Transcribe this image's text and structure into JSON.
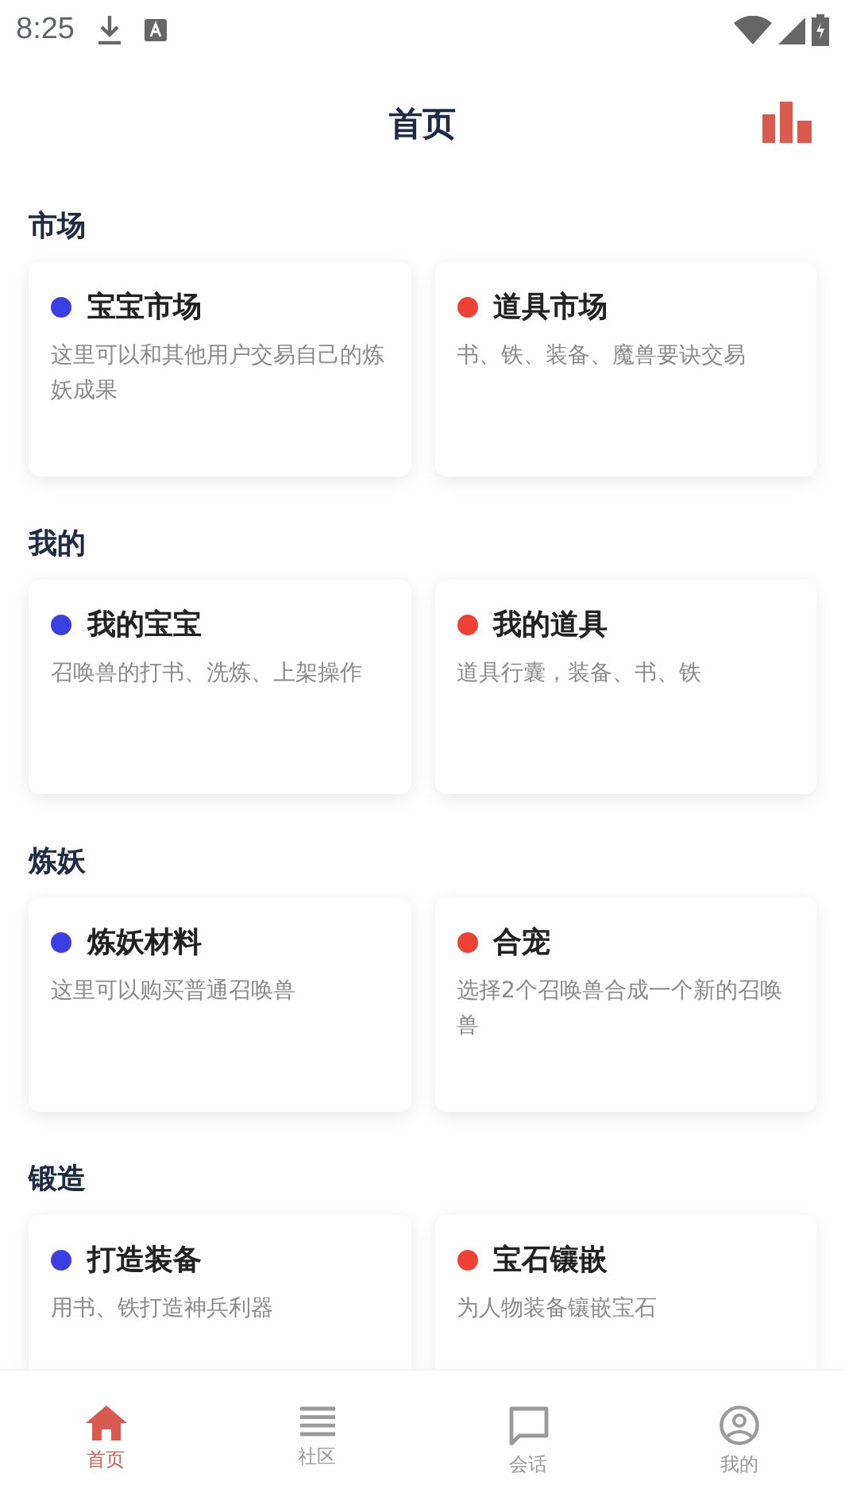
{
  "status_bar": {
    "time": "8:25"
  },
  "header": {
    "title": "首页"
  },
  "sections": [
    {
      "title": "市场",
      "cards": [
        {
          "title": "宝宝市场",
          "description": "这里可以和其他用户交易自己的炼妖成果",
          "color": "#3b3ee0"
        },
        {
          "title": "道具市场",
          "description": "书、铁、装备、魔兽要诀交易",
          "color": "#ef4136"
        }
      ]
    },
    {
      "title": "我的",
      "cards": [
        {
          "title": "我的宝宝",
          "description": "召唤兽的打书、洗炼、上架操作",
          "color": "#3b3ee0"
        },
        {
          "title": "我的道具",
          "description": "道具行囊，装备、书、铁",
          "color": "#ef4136"
        }
      ]
    },
    {
      "title": "炼妖",
      "cards": [
        {
          "title": "炼妖材料",
          "description": "这里可以购买普通召唤兽",
          "color": "#3b3ee0"
        },
        {
          "title": "合宠",
          "description": "选择2个召唤兽合成一个新的召唤兽",
          "color": "#ef4136"
        }
      ]
    },
    {
      "title": "锻造",
      "cards": [
        {
          "title": "打造装备",
          "description": "用书、铁打造神兵利器",
          "color": "#3b3ee0"
        },
        {
          "title": "宝石镶嵌",
          "description": "为人物装备镶嵌宝石",
          "color": "#ef4136"
        }
      ]
    }
  ],
  "tabs": [
    {
      "label": "首页",
      "kind": "home",
      "selected": true
    },
    {
      "label": "社区",
      "kind": "list",
      "selected": false
    },
    {
      "label": "会话",
      "kind": "chat",
      "selected": false
    },
    {
      "label": "我的",
      "kind": "profile",
      "selected": false
    }
  ]
}
